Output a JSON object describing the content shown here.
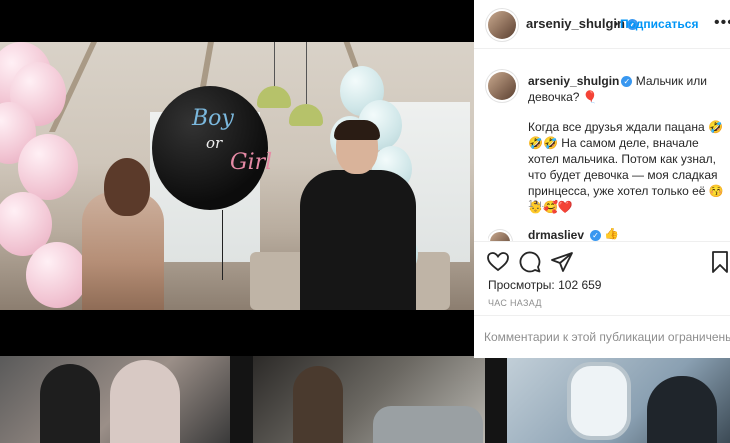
{
  "post": {
    "username": "arseniy_shulgin",
    "follow_label": "Подписаться",
    "caption_title": "Мальчик или девочка? 🎈",
    "caption_body": "Когда все друзья ждали пацана 🤣🤣🤣 На самом деле, вначале хотел мальчика. Потом как узнал, что будет девочка — моя сладкая принцесса, уже хотел только её 😚👶🥰❤️",
    "time_ago": "1 ч.",
    "comment_username": "drmasliev",
    "comment_emoji": "👍",
    "views_label": "Просмотры: 102 659",
    "posted_label": "ЧАС НАЗАД",
    "comments_limited": "Комментарии к этой публикации ограничены"
  },
  "video": {
    "balloon_text_1": "Boy",
    "balloon_text_2": "or",
    "balloon_text_3": "Girl"
  },
  "icons": {
    "more": "more-icon",
    "verified": "verified-icon",
    "like": "heart-icon",
    "comment": "comment-icon",
    "share": "share-icon",
    "save": "bookmark-icon",
    "volume": "volume-icon"
  },
  "colors": {
    "accent": "#0095f6",
    "verified": "#3897f0",
    "text": "#262626",
    "muted": "#8e8e8e"
  }
}
